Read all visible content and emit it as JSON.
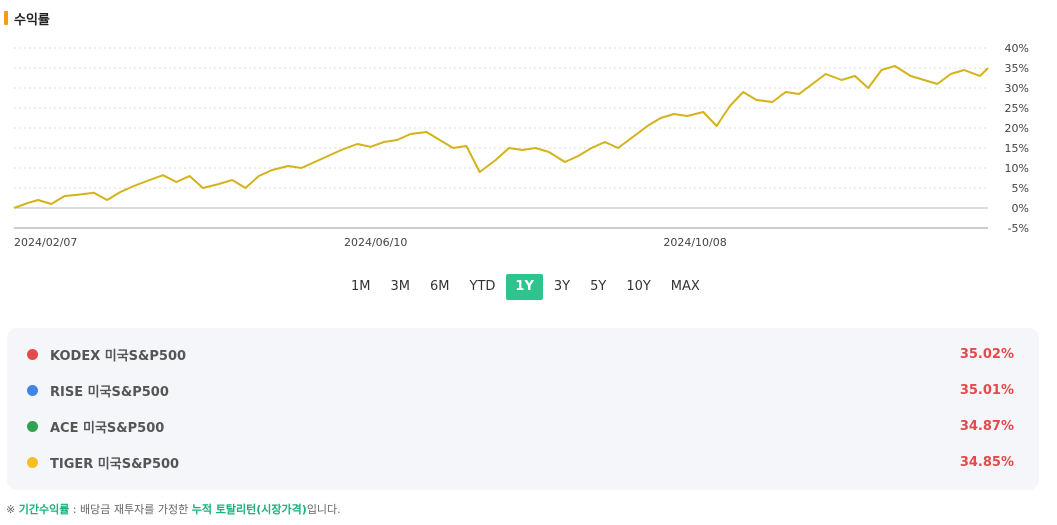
{
  "section": {
    "title": "수익률",
    "accent_color": "#f59d0a"
  },
  "chart_data": {
    "type": "line",
    "y_tick_labels": [
      "40%",
      "35%",
      "30%",
      "25%",
      "20%",
      "15%",
      "10%",
      "5%",
      "0%",
      "-5%"
    ],
    "y_ticks": [
      40,
      35,
      30,
      25,
      20,
      15,
      10,
      5,
      0,
      -5
    ],
    "ylim": [
      -5,
      40
    ],
    "x_tick_labels": [
      "2024/02/07",
      "2024/06/10",
      "2024/10/08"
    ],
    "x_range": [
      "2024/02/07",
      "2025/02/07"
    ],
    "grid": "horizontal-dotted",
    "series": [
      {
        "color": "#d4b21a",
        "x": [
          "2024/02/07",
          "2024/02/12",
          "2024/02/16",
          "2024/02/21",
          "2024/02/26",
          "2024/03/02",
          "2024/03/08",
          "2024/03/13",
          "2024/03/18",
          "2024/03/23",
          "2024/03/29",
          "2024/04/03",
          "2024/04/08",
          "2024/04/13",
          "2024/04/18",
          "2024/04/24",
          "2024/04/29",
          "2024/05/04",
          "2024/05/09",
          "2024/05/14",
          "2024/05/20",
          "2024/05/25",
          "2024/05/30",
          "2024/06/04",
          "2024/06/09",
          "2024/06/15",
          "2024/06/20",
          "2024/06/25",
          "2024/06/30",
          "2024/07/05",
          "2024/07/11",
          "2024/07/16",
          "2024/07/21",
          "2024/07/26",
          "2024/07/31",
          "2024/08/06",
          "2024/08/11",
          "2024/08/16",
          "2024/08/21",
          "2024/08/26",
          "2024/09/01",
          "2024/09/06",
          "2024/09/11",
          "2024/09/16",
          "2024/09/21",
          "2024/09/27",
          "2024/10/02",
          "2024/10/07",
          "2024/10/12",
          "2024/10/17",
          "2024/10/23",
          "2024/10/28",
          "2024/11/02",
          "2024/11/07",
          "2024/11/12",
          "2024/11/18",
          "2024/11/23",
          "2024/11/28",
          "2024/12/03",
          "2024/12/08",
          "2024/12/14",
          "2024/12/19",
          "2024/12/24",
          "2024/12/29",
          "2025/01/03",
          "2025/01/09",
          "2025/01/14",
          "2025/01/19",
          "2025/01/24",
          "2025/01/29",
          "2025/02/04",
          "2025/02/07"
        ],
        "y": [
          0,
          1.2,
          2.0,
          1.0,
          3.0,
          3.3,
          3.8,
          2.0,
          4.0,
          5.5,
          7.0,
          8.2,
          6.5,
          8.0,
          5.0,
          6.0,
          7.0,
          5.0,
          8.0,
          9.5,
          10.5,
          10.0,
          11.5,
          13.0,
          14.5,
          16.0,
          15.3,
          16.5,
          17.0,
          18.5,
          19.0,
          17.0,
          15.0,
          15.5,
          9.0,
          12.0,
          15.0,
          14.5,
          15.0,
          14.0,
          11.5,
          13.0,
          15.0,
          16.5,
          15.0,
          18.0,
          20.5,
          22.5,
          23.5,
          23.0,
          24.0,
          20.5,
          25.5,
          29.0,
          27.0,
          26.5,
          29.0,
          28.5,
          31.0,
          33.5,
          32.0,
          33.0,
          30.0,
          34.5,
          35.5,
          33.0,
          32.0,
          31.0,
          33.5,
          34.5,
          33.0,
          35.0
        ]
      }
    ]
  },
  "range_buttons": [
    "1M",
    "3M",
    "6M",
    "YTD",
    "1Y",
    "3Y",
    "5Y",
    "10Y",
    "MAX"
  ],
  "range_active": "1Y",
  "range_active_color": "#2ec48e",
  "funds": [
    {
      "name": "KODEX 미국S&P500",
      "value": "35.02%",
      "color": "#e54b4b"
    },
    {
      "name": "RISE 미국S&P500",
      "value": "35.01%",
      "color": "#3f86e6"
    },
    {
      "name": "ACE 미국S&P500",
      "value": "34.87%",
      "color": "#2fa352"
    },
    {
      "name": "TIGER 미국S&P500",
      "value": "34.85%",
      "color": "#f5c01f"
    }
  ],
  "footnote": {
    "symbol": "※",
    "highlight1": "기간수익률",
    "text1": " : 배당금 재투자를 가정한 ",
    "highlight2": "누적 토탈리턴(시장가격)",
    "text2": "입니다."
  }
}
